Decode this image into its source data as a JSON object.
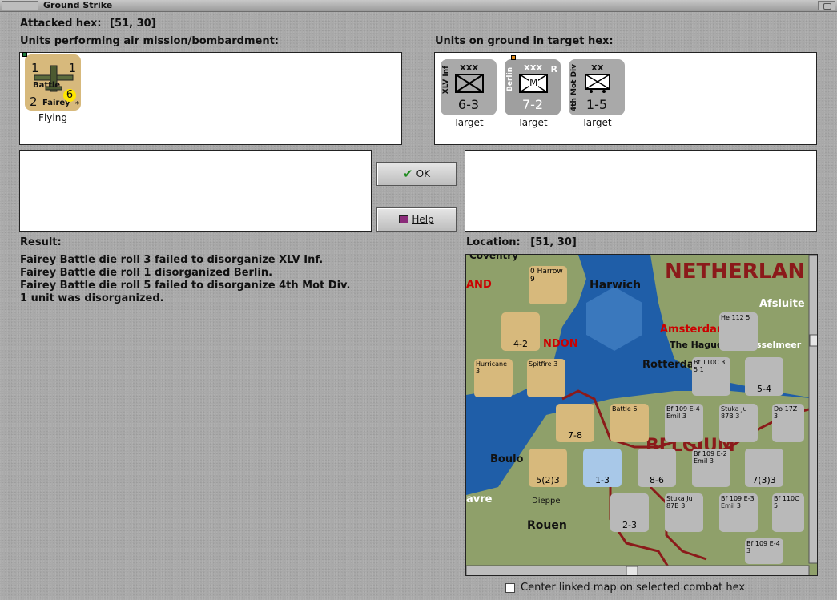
{
  "window": {
    "title": "Ground Strike"
  },
  "attacked_hex": {
    "label": "Attacked hex:",
    "value": "[51, 30]"
  },
  "air_units": {
    "label": "Units performing air mission/bombardment:",
    "items": [
      {
        "name_top": "Battle",
        "name_bottom": "Fairey",
        "tl": "1",
        "tr": "1",
        "bl": "2",
        "br": "6",
        "star": "*",
        "status": "Flying"
      }
    ]
  },
  "ground_units": {
    "label": "Units on ground in target hex:",
    "items": [
      {
        "side": "XLV Inf",
        "size": "XXX",
        "strength": "6-3",
        "marker": "",
        "status": "Target"
      },
      {
        "side": "Berlin",
        "size": "XXX",
        "strength": "7-2",
        "marker": "M",
        "corner": "R",
        "status": "Target"
      },
      {
        "side": "4th Mot Div",
        "size": "XX",
        "strength": "1-5",
        "marker": "",
        "status": "Target"
      }
    ]
  },
  "buttons": {
    "ok": "OK",
    "help": "Help"
  },
  "result": {
    "label": "Result:",
    "lines": [
      "Fairey Battle die roll 3 failed to disorganize XLV Inf.",
      "Fairey Battle die roll 1 disorganized Berlin.",
      "Fairey Battle die roll 5 failed to disorganize 4th Mot Div.",
      "1 unit was disorganized."
    ]
  },
  "location": {
    "label": "Location:",
    "value": "[51, 30]",
    "map_labels": {
      "netherlands": "NETHERLAN",
      "harwich": "Harwich",
      "amsterdam": "Amsterdam",
      "the_hague": "The Hague",
      "rotterdam": "Rotterda",
      "london": "NDON",
      "belgium": "BELGIUM",
      "boulogne": "Boulo",
      "rouen": "Rouen",
      "dieppe": "Dieppe",
      "coventry": "Coventry",
      "afsluit": "Afsluite",
      "ijsselmeer": "sselmeer",
      "land": "AND",
      "havre": "avre"
    },
    "map_counters": [
      {
        "text": "0 Harrow 9"
      },
      {
        "text": "4-2"
      },
      {
        "text": "Hurricane 3"
      },
      {
        "text": "Spitfire 3"
      },
      {
        "text": "He 112 5"
      },
      {
        "text": "Bf 110C 3 5 1"
      },
      {
        "text": "5-4"
      },
      {
        "text": "7-8"
      },
      {
        "text": "Battle 6"
      },
      {
        "text": "Bf 109 E-4 Emil 3"
      },
      {
        "text": "Stuka Ju 87B 3"
      },
      {
        "text": "Do 17Z 3"
      },
      {
        "text": "5(2)3"
      },
      {
        "text": "1-3"
      },
      {
        "text": "8-6"
      },
      {
        "text": "Bf 109 E-2 Emil 3"
      },
      {
        "text": "7(3)3"
      },
      {
        "text": "2-3"
      },
      {
        "text": "Stuka Ju 87B 3"
      },
      {
        "text": "Bf 109 E-3 Emil 3"
      },
      {
        "text": "Bf 110C 5"
      },
      {
        "text": "Bf 109 E-4 3"
      }
    ]
  },
  "center_option": {
    "label": "Center linked map on selected combat hex",
    "checked": false
  },
  "colors": {
    "background": "#a9a9a9",
    "sea": "#1f5ea8",
    "land": "#8fa06a",
    "axis_counter": "#b9b9b9",
    "allied_counter": "#d7b97c",
    "border_red": "#8b1a1a"
  }
}
